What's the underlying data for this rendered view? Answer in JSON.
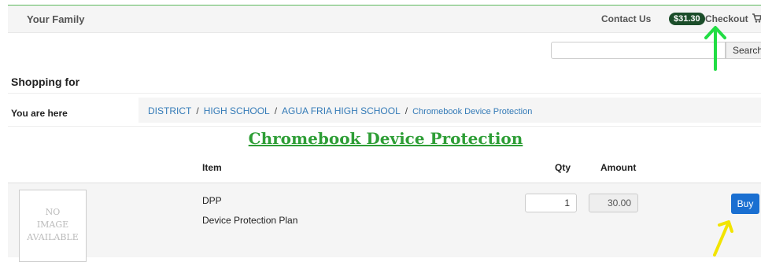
{
  "header": {
    "brand": "Your Family",
    "contact": "Contact Us",
    "cart_total": "$31.30",
    "checkout": "Checkout",
    "icons": {
      "cart": "shopping-cart-icon"
    },
    "accent": "#5cb85c"
  },
  "search": {
    "value": "",
    "button": "Search"
  },
  "shopping_for": "Shopping for",
  "you_are_here": "You are here",
  "breadcrumb": [
    "DISTRICT",
    "HIGH SCHOOL",
    "AGUA FRIA HIGH SCHOOL",
    "Chromebook Device Protection"
  ],
  "page_title": "Chromebook Device Protection",
  "table": {
    "headers": {
      "item": "Item",
      "qty": "Qty",
      "amount": "Amount"
    },
    "rows": [
      {
        "image_text": [
          "NO",
          "IMAGE",
          "AVAILABLE"
        ],
        "sku": "DPP",
        "description": "Device Protection Plan",
        "qty": "1",
        "amount": "30.00",
        "buy": "Buy"
      }
    ]
  },
  "annotations": {
    "arrow_colors": {
      "green": "#22dd44",
      "yellow": "#f2e400"
    }
  }
}
